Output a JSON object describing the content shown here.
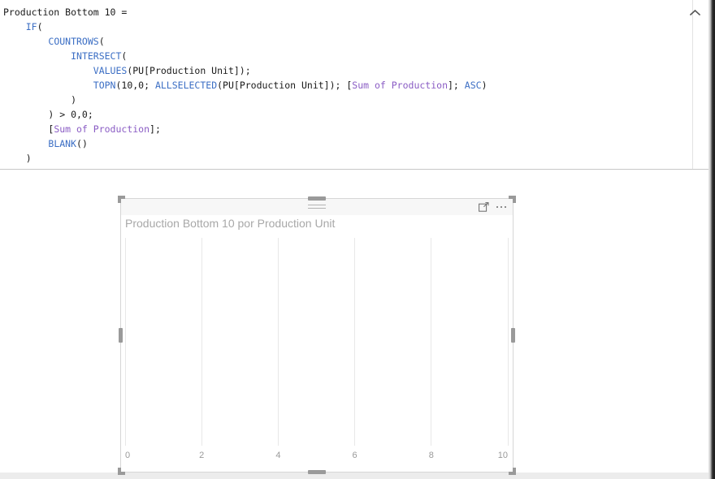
{
  "formula_bar": {
    "collapse_icon": "chevron-up-icon",
    "lines": [
      [
        {
          "t": "Production Bottom 10 =",
          "c": "plain"
        }
      ],
      [
        {
          "t": "    ",
          "c": "plain"
        },
        {
          "t": "IF",
          "c": "fn"
        },
        {
          "t": "(",
          "c": "plain"
        }
      ],
      [
        {
          "t": "        ",
          "c": "plain"
        },
        {
          "t": "COUNTROWS",
          "c": "fn"
        },
        {
          "t": "(",
          "c": "plain"
        }
      ],
      [
        {
          "t": "            ",
          "c": "plain"
        },
        {
          "t": "INTERSECT",
          "c": "fn"
        },
        {
          "t": "(",
          "c": "plain"
        }
      ],
      [
        {
          "t": "                ",
          "c": "plain"
        },
        {
          "t": "VALUES",
          "c": "fn"
        },
        {
          "t": "(PU[Production Unit]);",
          "c": "plain"
        }
      ],
      [
        {
          "t": "                ",
          "c": "plain"
        },
        {
          "t": "TOPN",
          "c": "fn"
        },
        {
          "t": "(10,0; ",
          "c": "plain"
        },
        {
          "t": "ALLSELECTED",
          "c": "fn"
        },
        {
          "t": "(PU[Production Unit]); [",
          "c": "plain"
        },
        {
          "t": "Sum of Production",
          "c": "meas"
        },
        {
          "t": "]; ",
          "c": "plain"
        },
        {
          "t": "ASC",
          "c": "fn"
        },
        {
          "t": ")",
          "c": "plain"
        }
      ],
      [
        {
          "t": "            )",
          "c": "plain"
        }
      ],
      [
        {
          "t": "        ) > 0,0;",
          "c": "plain"
        }
      ],
      [
        {
          "t": "        [",
          "c": "plain"
        },
        {
          "t": "Sum of Production",
          "c": "meas"
        },
        {
          "t": "];",
          "c": "plain"
        }
      ],
      [
        {
          "t": "        ",
          "c": "plain"
        },
        {
          "t": "BLANK",
          "c": "fn"
        },
        {
          "t": "()",
          "c": "plain"
        }
      ],
      [
        {
          "t": "    )",
          "c": "plain"
        }
      ]
    ]
  },
  "visual": {
    "title": "Production Bottom 10 por Production Unit",
    "focus_icon": "focus-mode-icon",
    "more_icon": "more-options-icon",
    "drag_handle_icon": "drag-handle-icon",
    "state": "selected"
  },
  "chart_data": {
    "type": "bar",
    "title": "Production Bottom 10 por Production Unit",
    "orientation": "horizontal",
    "categories": [],
    "values": [],
    "series": [
      {
        "name": "Production Bottom 10",
        "values": []
      }
    ],
    "xlabel": "",
    "ylabel": "Production Unit",
    "xticks": [
      "0",
      "2",
      "4",
      "6",
      "8",
      "10"
    ],
    "xtick_values": [
      0,
      2,
      4,
      6,
      8,
      10
    ],
    "xlim": [
      0,
      10
    ],
    "grid": true,
    "gridlines_axis": "x",
    "legend": "none",
    "empty": true,
    "note": "No data points rendered — plot area is blank"
  },
  "colors": {
    "function_blue": "#3b6ec4",
    "measure_purple": "#8a5cc4",
    "code_black": "#1a1a1a",
    "title_grey": "#a8a8a8",
    "tick_grey": "#9a9a9a",
    "gridline": "#e8e8e8",
    "visual_border": "#d6d6d6",
    "handle_grey": "#9a9a9a",
    "canvas_bg": "#ffffff"
  }
}
